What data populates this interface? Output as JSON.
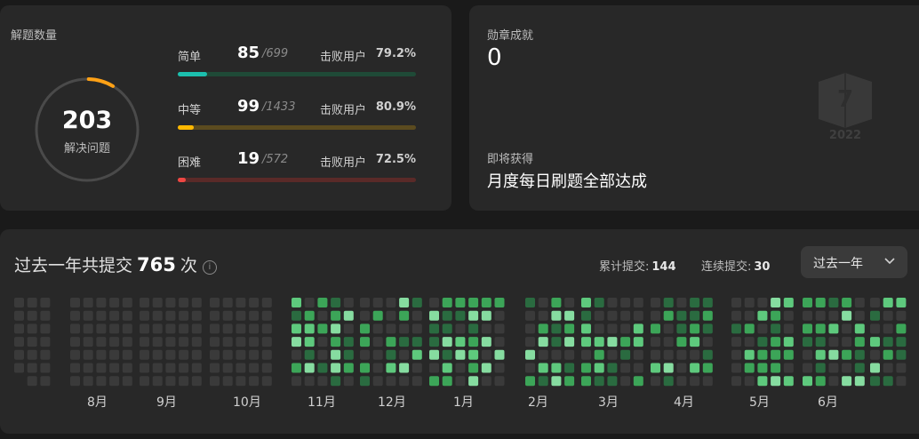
{
  "solved": {
    "title": "解题数量",
    "total": "203",
    "total_label": "解决问题",
    "difficulties": [
      {
        "name": "简单",
        "count": "85",
        "total": "/699",
        "beat_label": "击败用户",
        "beat": "79.2%",
        "progress": 0.122,
        "color": "#1cbfae",
        "track": "#1f4a37"
      },
      {
        "name": "中等",
        "count": "99",
        "total": "/1433",
        "beat_label": "击败用户",
        "beat": "80.9%",
        "progress": 0.069,
        "color": "#ffb800",
        "track": "#5b4b1f"
      },
      {
        "name": "困难",
        "count": "19",
        "total": "/572",
        "beat_label": "击败用户",
        "beat": "72.5%",
        "progress": 0.033,
        "color": "#ef4743",
        "track": "#5a2a28"
      }
    ]
  },
  "badges": {
    "title": "勋章成就",
    "count": "0",
    "badge_icon": "2022-badge-icon",
    "badge_year": "2022",
    "upcoming_label": "即将获得",
    "upcoming_name": "月度每日刷题全部达成"
  },
  "submissions": {
    "prefix": "过去一年共提交",
    "count": "765",
    "suffix": "次",
    "info_icon": "i",
    "total_label": "累计提交:",
    "total_value": "144",
    "streak_label": "连续提交:",
    "streak_value": "30",
    "range_select": "过去一年",
    "months": [
      "8月",
      "9月",
      "10月",
      "11月",
      "12月",
      "1月",
      "2月",
      "3月",
      "4月",
      "5月",
      "6月"
    ]
  },
  "colors": {
    "empty": "#3a3a3a",
    "level1": "#2a6b40",
    "level2": "#3ca558",
    "level3": "#5ec97d",
    "level4": "#86dca0"
  }
}
